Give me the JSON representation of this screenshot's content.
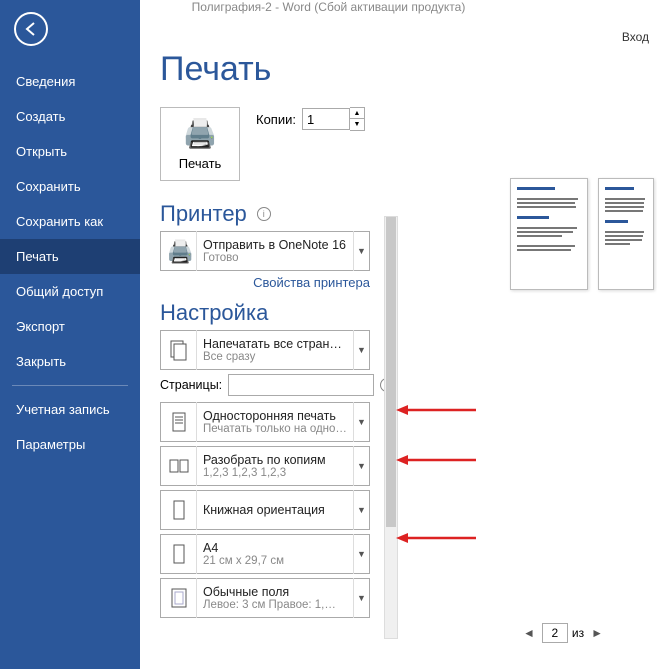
{
  "titlebar": "Полиграфия-2 - Word (Сбой активации продукта)",
  "account": "Вход",
  "sidebar": {
    "items": [
      "Сведения",
      "Создать",
      "Открыть",
      "Сохранить",
      "Сохранить как",
      "Печать",
      "Общий доступ",
      "Экспорт",
      "Закрыть",
      "Учетная запись",
      "Параметры"
    ],
    "active_index": 5
  },
  "page_title": "Печать",
  "print_button": "Печать",
  "copies": {
    "label": "Копии:",
    "value": "1"
  },
  "printer_section": "Принтер",
  "printer": {
    "name": "Отправить в OneNote 16",
    "status": "Готово"
  },
  "printer_props_link": "Свойства принтера",
  "settings_section": "Настройка",
  "opt_pages": {
    "line1": "Напечатать все страницы",
    "line2": "Все сразу"
  },
  "pages_field": {
    "label": "Страницы:",
    "value": ""
  },
  "opt_sides": {
    "line1": "Односторонняя печать",
    "line2": "Печатать только на одно…"
  },
  "opt_collate": {
    "line1": "Разобрать по копиям",
    "line2": "1,2,3    1,2,3    1,2,3"
  },
  "opt_orient": {
    "line1": "Книжная ориентация",
    "line2": ""
  },
  "opt_size": {
    "line1": "A4",
    "line2": "21 см x 29,7 см"
  },
  "opt_margins": {
    "line1": "Обычные поля",
    "line2": "Левое: 3 см   Правое: 1,…"
  },
  "preview_footer": {
    "page_value": "2",
    "of_label": "из"
  }
}
